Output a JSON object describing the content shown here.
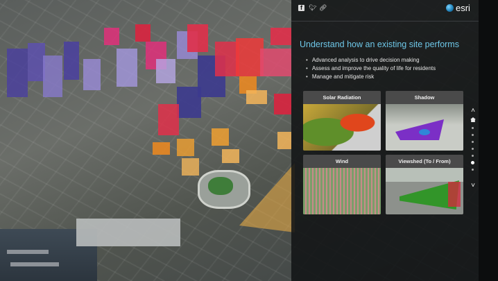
{
  "header": {
    "share_icons": [
      "facebook-icon",
      "twitter-icon",
      "link-icon"
    ],
    "logo_text": "esri"
  },
  "main": {
    "title": "Understand how an existing site performs",
    "bullets": [
      "Advanced analysis to drive decision making",
      "Assess and improve the quality of life for residents",
      "Manage and mitigate risk"
    ],
    "cards": [
      {
        "label": "Solar Radiation"
      },
      {
        "label": "Shadow"
      },
      {
        "label": "Wind"
      },
      {
        "label": "Viewshed (To / From)"
      }
    ]
  },
  "nav": {
    "up_icon": "chevron-up-icon",
    "down_icon": "chevron-down-icon",
    "home_icon": "home-icon",
    "dot_count": 7,
    "active_dot": 6
  },
  "colors": {
    "title": "#6ec7e8",
    "panel": "#121416",
    "shadow_purple": "#7b2fc6",
    "building_red": "#e0304a",
    "building_blue": "#3c3a8e"
  }
}
